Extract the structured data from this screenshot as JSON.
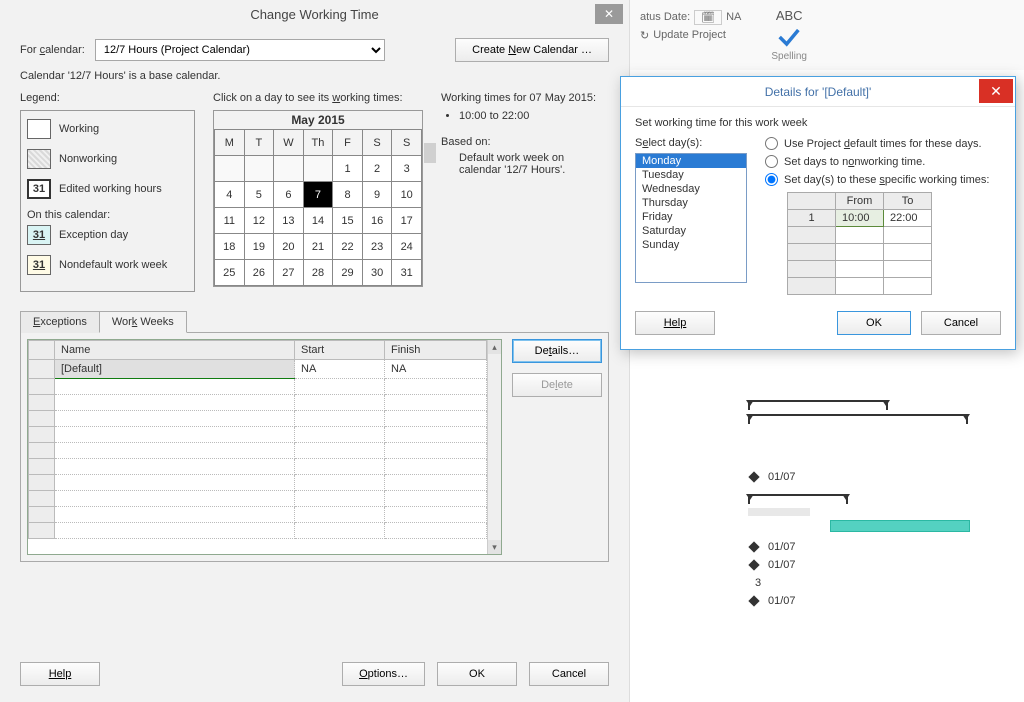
{
  "ribbon": {
    "status_date_label": "atus Date:",
    "na": "NA",
    "update_project": "Update Project",
    "spelling_abc": "ABC",
    "spelling_label": "Spelling"
  },
  "main_dialog": {
    "title": "Change Working Time",
    "for_calendar_label": "For calendar:",
    "for_calendar_value": "12/7 Hours (Project Calendar)",
    "create_new": "Create New Calendar …",
    "base_note": "Calendar '12/7 Hours' is a base calendar.",
    "legend": {
      "heading": "Legend:",
      "working": "Working",
      "nonworking": "Nonworking",
      "edited_text": "Edited working hours",
      "edited_num": "31",
      "on_this": "On this calendar:",
      "exception_num": "31",
      "exception_text": "Exception day",
      "nondefault_num": "31",
      "nondefault_text": "Nondefault work week"
    },
    "calendar": {
      "instruction": "Click on a day to see its working times:",
      "month_title": "May 2015",
      "dow": [
        "M",
        "T",
        "W",
        "Th",
        "F",
        "S",
        "S"
      ],
      "weeks": [
        [
          "",
          "",
          "",
          "",
          "1",
          "2",
          "3"
        ],
        [
          "4",
          "5",
          "6",
          "7",
          "8",
          "9",
          "10"
        ],
        [
          "11",
          "12",
          "13",
          "14",
          "15",
          "16",
          "17"
        ],
        [
          "18",
          "19",
          "20",
          "21",
          "22",
          "23",
          "24"
        ],
        [
          "25",
          "26",
          "27",
          "28",
          "29",
          "30",
          "31"
        ]
      ],
      "selected": "7"
    },
    "working_times": {
      "heading": "Working times for 07 May 2015:",
      "bullet": "10:00 to 22:00",
      "based_on_label": "Based on:",
      "based_on_text": "Default work week on calendar '12/7 Hours'."
    },
    "tabs": {
      "exceptions": "Exceptions",
      "work_weeks": "Work Weeks"
    },
    "grid": {
      "cols": {
        "name": "Name",
        "start": "Start",
        "finish": "Finish"
      },
      "rows": [
        {
          "name": "[Default]",
          "start": "NA",
          "finish": "NA"
        }
      ]
    },
    "side": {
      "details": "Details…",
      "delete": "Delete"
    },
    "footer": {
      "help": "Help",
      "options": "Options…",
      "ok": "OK",
      "cancel": "Cancel"
    }
  },
  "details_dialog": {
    "title": "Details for '[Default]'",
    "intro": "Set working time for this work week",
    "select_days_label": "Select day(s):",
    "days": [
      "Monday",
      "Tuesday",
      "Wednesday",
      "Thursday",
      "Friday",
      "Saturday",
      "Sunday"
    ],
    "selected_day": "Monday",
    "radios": {
      "default": "Use Project default times for these days.",
      "nonworking": "Set days to nonworking time.",
      "specific": "Set day(s) to these specific working times:"
    },
    "time_grid": {
      "from": "From",
      "to": "To",
      "rows": [
        {
          "idx": "1",
          "from": "10:00",
          "to": "22:00"
        }
      ]
    },
    "footer": {
      "help": "Help",
      "ok": "OK",
      "cancel": "Cancel"
    }
  },
  "gantt": {
    "date_label": "01/07"
  }
}
